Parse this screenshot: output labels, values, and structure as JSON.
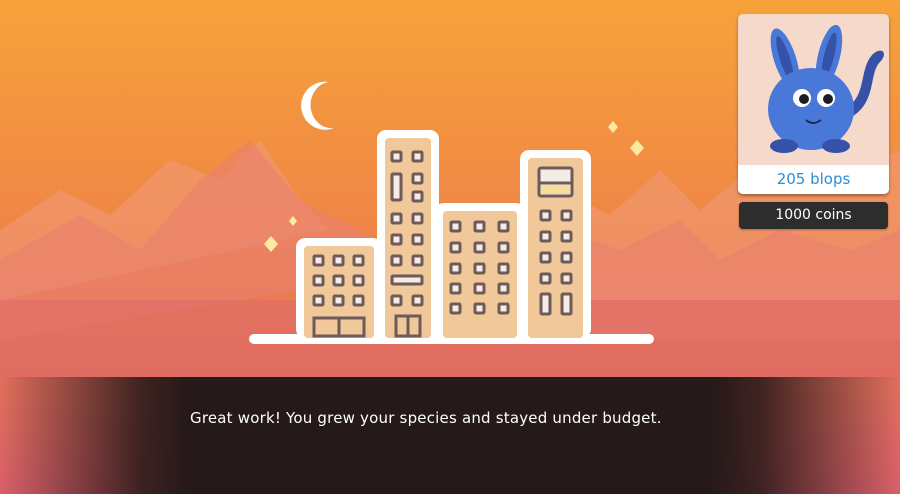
{
  "colors": {
    "sky_top": "#f7a23a",
    "sky_bottom": "#d9606a",
    "building_fill": "#f0c89a",
    "building_outline": "#ffffff",
    "window_color": "#6e5a58",
    "sparkle": "#fde9a0",
    "creature": "#4a78d8",
    "blops_text": "#2b8ed8",
    "coins_bg": "#2d2d2d",
    "dialog_bg": "#251919"
  },
  "icons": {
    "moon": "crescent-moon-icon",
    "sparkle": "sparkle-icon",
    "creature": "blue-bunny-creature"
  },
  "species_card": {
    "blops_label": "205 blops"
  },
  "wallet": {
    "coins_label": "1000 coins"
  },
  "dialog": {
    "message": "Great work! You grew your species and stayed under budget."
  }
}
